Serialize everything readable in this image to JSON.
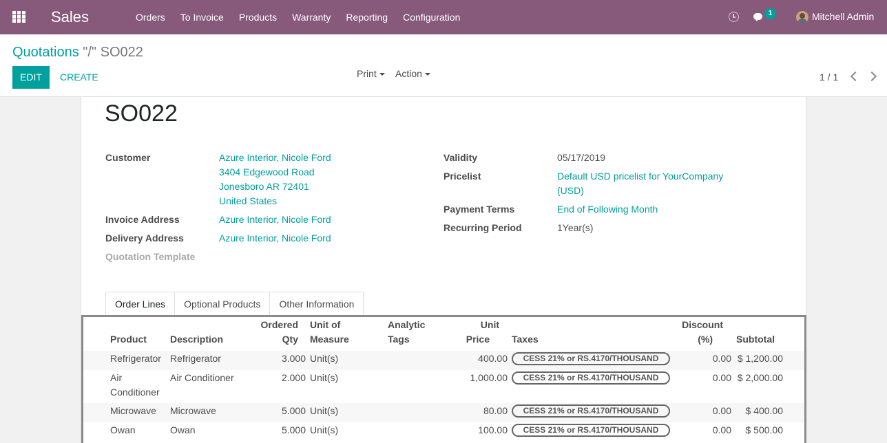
{
  "nav": {
    "app_title": "Sales",
    "menu": [
      "Orders",
      "To Invoice",
      "Products",
      "Warranty",
      "Reporting",
      "Configuration"
    ],
    "messages_count": "1",
    "user_name": "Mitchell Admin"
  },
  "control_panel": {
    "breadcrumb_parent": "Quotations",
    "breadcrumb_separator": "\"/\"",
    "breadcrumb_current": "SO022",
    "edit_label": "EDIT",
    "create_label": "CREATE",
    "print_label": "Print",
    "action_label": "Action",
    "pager": "1 / 1"
  },
  "record": {
    "name": "SO022",
    "customer_label": "Customer",
    "customer_name": "Azure Interior, Nicole Ford",
    "customer_street": "3404 Edgewood Road",
    "customer_city": "Jonesboro AR 72401",
    "customer_country": "United States",
    "invoice_address_label": "Invoice Address",
    "invoice_address": "Azure Interior, Nicole Ford",
    "delivery_address_label": "Delivery Address",
    "delivery_address": "Azure Interior, Nicole Ford",
    "quotation_template_label": "Quotation Template",
    "validity_label": "Validity",
    "validity": "05/17/2019",
    "pricelist_label": "Pricelist",
    "pricelist_line1": "Default USD pricelist for YourCompany",
    "pricelist_line2": "(USD)",
    "payment_terms_label": "Payment Terms",
    "payment_terms": "End of Following Month",
    "recurring_label": "Recurring Period",
    "recurring": "1Year(s)"
  },
  "tabs": [
    "Order Lines",
    "Optional Products",
    "Other Information"
  ],
  "order_lines": {
    "headers": {
      "product": "Product",
      "description": "Description",
      "qty_1": "Ordered",
      "qty_2": "Qty",
      "uom_1": "Unit of",
      "uom_2": "Measure",
      "tags_1": "Analytic",
      "tags_2": "Tags",
      "price_1": "Unit",
      "price_2": "Price",
      "taxes": "Taxes",
      "discount_1": "Discount",
      "discount_2": "(%)",
      "subtotal": "Subtotal"
    },
    "rows": [
      {
        "product": "Refrigerator",
        "product_2": "",
        "description": "Refrigerator",
        "qty": "3.000",
        "uom": "Unit(s)",
        "price": "400.00",
        "tax": "CESS 21% or RS.4170/THOUSAND",
        "discount": "0.00",
        "subtotal": "$ 1,200.00"
      },
      {
        "product": "Air",
        "product_2": "Conditioner",
        "description": "Air Conditioner",
        "qty": "2.000",
        "uom": "Unit(s)",
        "price": "1,000.00",
        "tax": "CESS 21% or RS.4170/THOUSAND",
        "discount": "0.00",
        "subtotal": "$ 2,000.00"
      },
      {
        "product": "Microwave",
        "product_2": "",
        "description": "Microwave",
        "qty": "5.000",
        "uom": "Unit(s)",
        "price": "80.00",
        "tax": "CESS 21% or RS.4170/THOUSAND",
        "discount": "0.00",
        "subtotal": "$ 400.00"
      },
      {
        "product": "Owan",
        "product_2": "",
        "description": "Owan",
        "qty": "5.000",
        "uom": "Unit(s)",
        "price": "100.00",
        "tax": "CESS 21% or RS.4170/THOUSAND",
        "discount": "0.00",
        "subtotal": "$ 500.00"
      }
    ]
  }
}
